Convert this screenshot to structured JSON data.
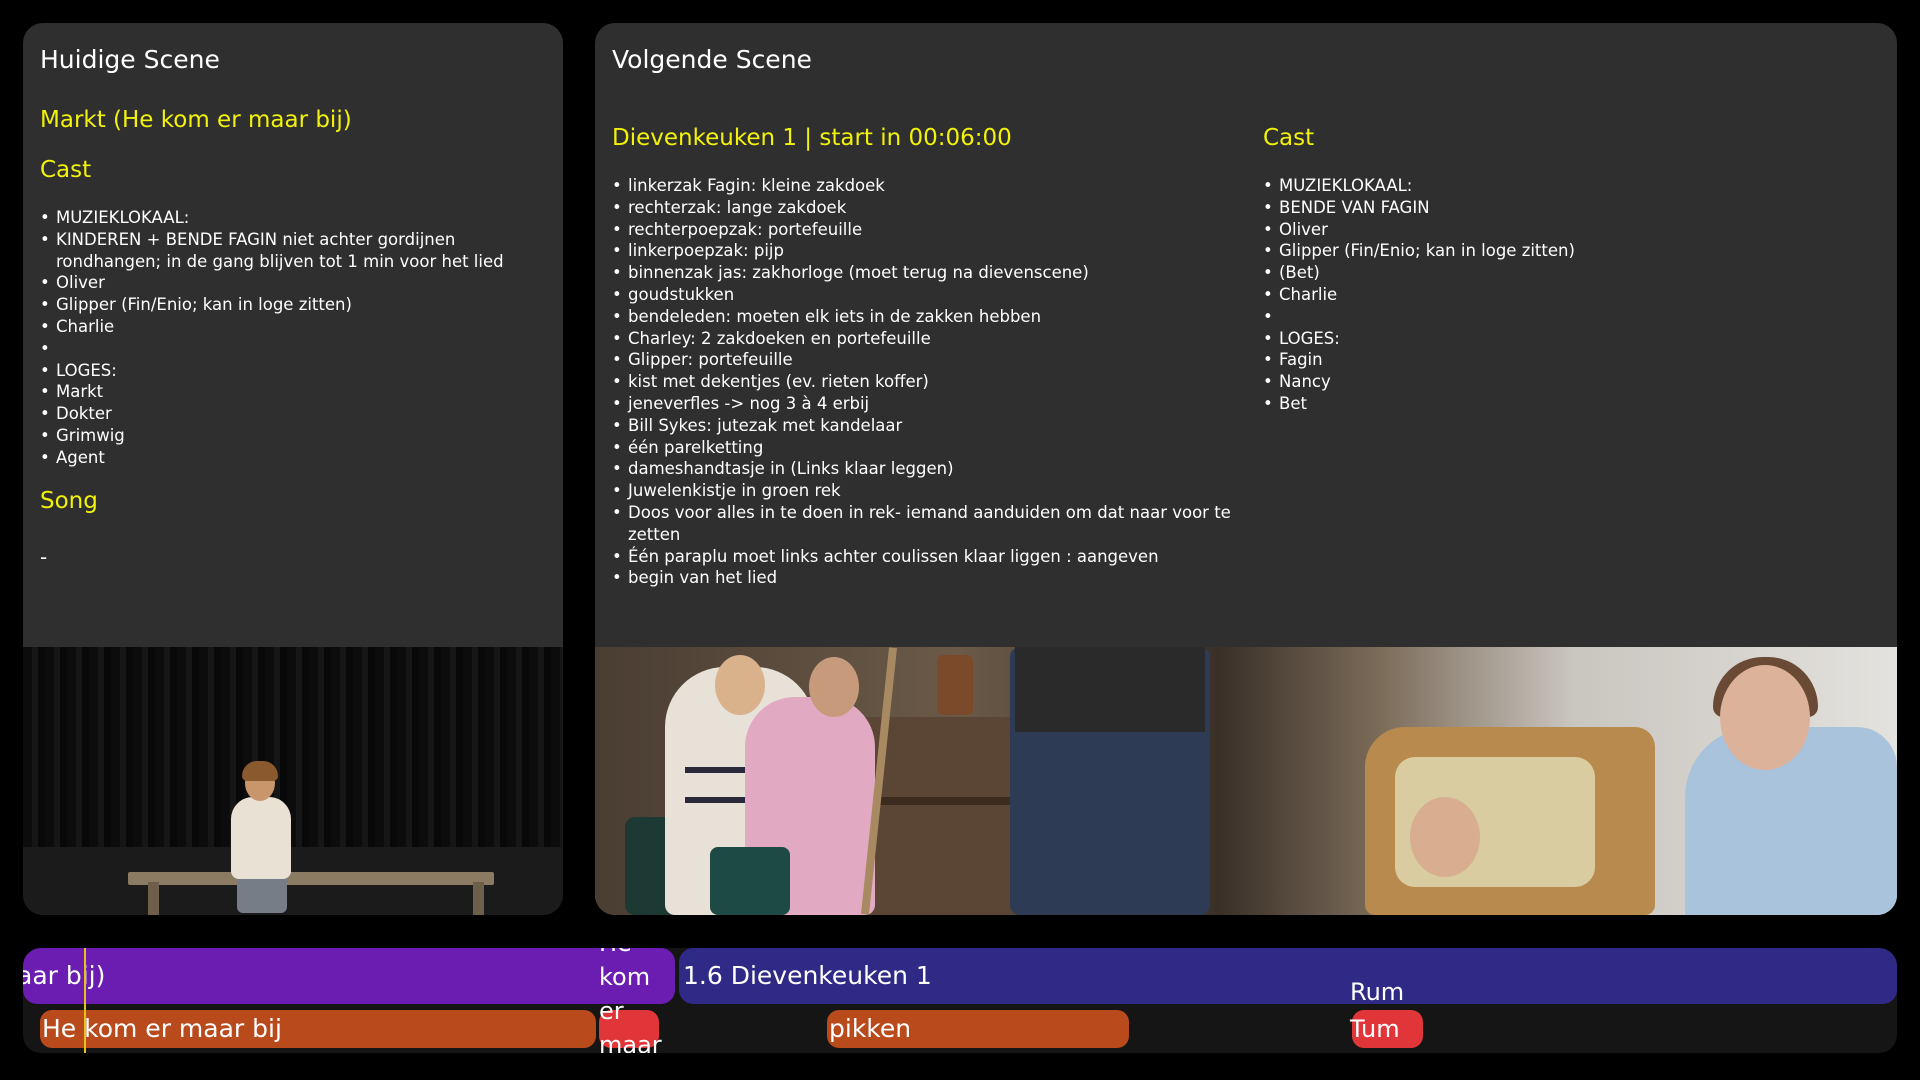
{
  "current": {
    "panel_title": "Huidige Scene",
    "scene_name": "Markt (He kom er maar bij)",
    "cast_heading": "Cast",
    "cast": [
      "MUZIEKLOKAAL:",
      "KINDEREN + BENDE FAGIN niet achter gordijnen rondhangen; in de gang blijven tot 1 min voor het lied",
      "Oliver",
      "Glipper (Fin/Enio; kan in loge zitten)",
      "Charlie",
      "",
      "LOGES:",
      "Markt",
      "Dokter",
      "Grimwig",
      "Agent"
    ],
    "song_heading": "Song",
    "song_value": "-"
  },
  "next": {
    "panel_title": "Volgende Scene",
    "scene_heading": "Dievenkeuken 1 | start in 00:06:00",
    "props": [
      "linkerzak Fagin: kleine zakdoek",
      "rechterzak: lange zakdoek",
      "rechterpoepzak: portefeuille",
      "linkerpoepzak: pijp",
      "binnenzak jas: zakhorloge (moet terug na dievenscene)",
      "goudstukken",
      "bendeleden: moeten elk iets in de zakken hebben",
      "Charley: 2 zakdoeken en portefeuille",
      "Glipper: portefeuille",
      "kist met dekentjes (ev. rieten koffer)",
      "jeneverfles -> nog 3 à 4 erbij",
      "Bill Sykes: jutezak met kandelaar",
      "één parelketting",
      "dameshandtasje in (Links klaar leggen)",
      "Juwelenkistje in groen rek",
      "Doos voor alles in te doen in rek- iemand aanduiden om dat naar voor te zetten",
      "Één paraplu moet links achter coulissen klaar liggen : aangeven",
      "begin van het lied"
    ],
    "cast_heading": "Cast",
    "cast": [
      "MUZIEKLOKAAL:",
      "BENDE VAN FAGIN",
      "Oliver",
      "Glipper (Fin/Enio; kan in loge zitten)",
      "(Bet)",
      "Charlie",
      "",
      "LOGES:",
      "Fagin",
      "Nancy",
      "Bet"
    ]
  },
  "timeline": {
    "scene_a": "aar bij)",
    "scene_b": "1.6 Dievenkeuken 1",
    "song_1": "He kom er maar bij",
    "song_2": "He kom er maar",
    "song_3": "pikken",
    "song_4_top": "Rum",
    "song_4": "Tum"
  },
  "colors": {
    "panel_bg": "#2f2f2f",
    "accent_yellow": "#f2f20a",
    "scene_a": "#6a1db0",
    "scene_b": "#2f2a86",
    "song_orange": "#b84a1c",
    "song_red": "#e0363a",
    "playhead": "#e8c21a"
  }
}
